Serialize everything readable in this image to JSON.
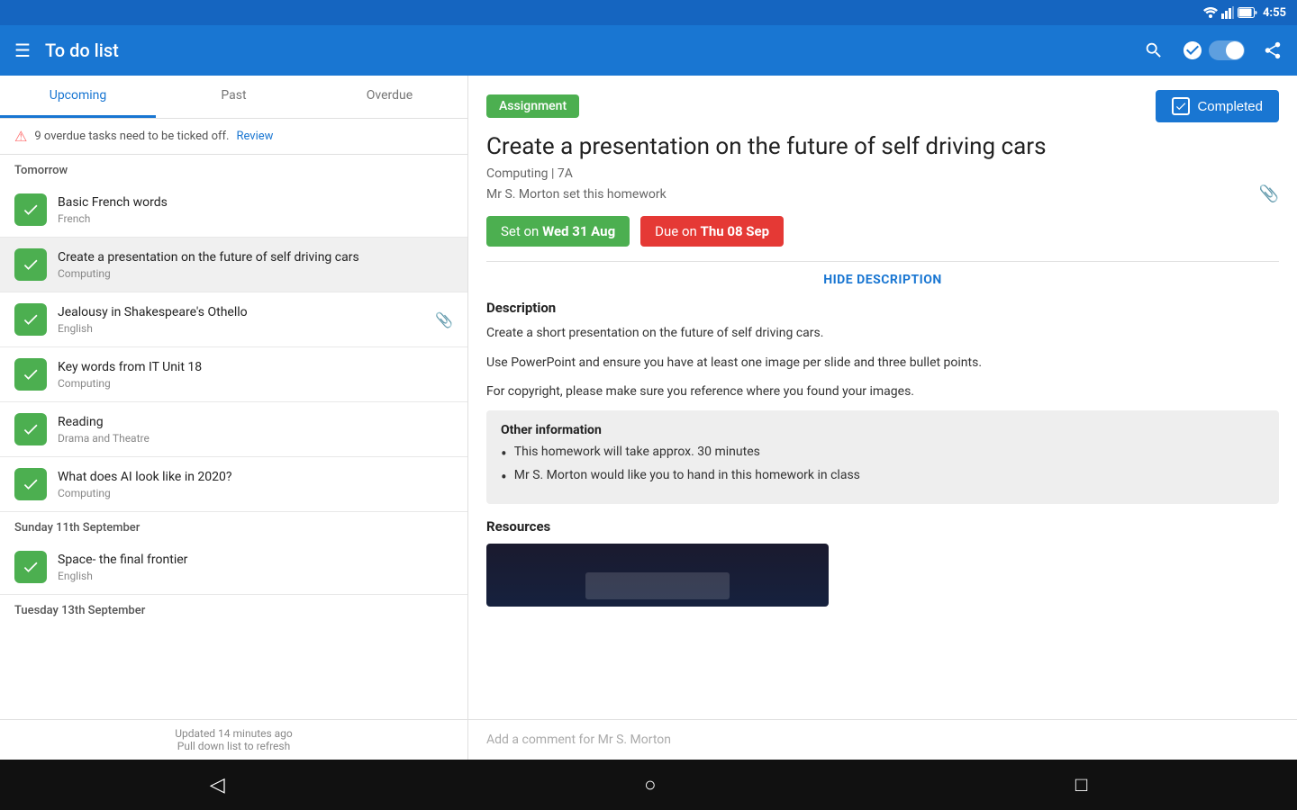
{
  "statusBar": {
    "time": "4:55"
  },
  "topBar": {
    "menuIcon": "☰",
    "title": "To do list",
    "searchIcon": "search",
    "checkIcon": "✓",
    "shareIcon": "share"
  },
  "tabs": [
    {
      "label": "Upcoming",
      "active": true
    },
    {
      "label": "Past",
      "active": false
    },
    {
      "label": "Overdue",
      "active": false
    }
  ],
  "warningBar": {
    "message": "9 overdue tasks need to be ticked off.",
    "reviewLabel": "Review"
  },
  "sections": [
    {
      "header": "Tomorrow",
      "tasks": [
        {
          "title": "Basic French words",
          "subject": "French",
          "checked": true,
          "attachment": false,
          "selected": false
        },
        {
          "title": "Create a presentation on the future of self driving cars",
          "subject": "Computing",
          "checked": true,
          "attachment": false,
          "selected": true
        },
        {
          "title": "Jealousy in Shakespeare's Othello",
          "subject": "English",
          "checked": true,
          "attachment": true,
          "selected": false
        },
        {
          "title": "Key words from IT Unit 18",
          "subject": "Computing",
          "checked": true,
          "attachment": false,
          "selected": false
        },
        {
          "title": "Reading",
          "subject": "Drama and Theatre",
          "checked": true,
          "attachment": false,
          "selected": false
        },
        {
          "title": "What does AI look like in 2020?",
          "subject": "Computing",
          "checked": true,
          "attachment": false,
          "selected": false
        }
      ]
    },
    {
      "header": "Sunday 11th September",
      "tasks": [
        {
          "title": "Space- the final frontier",
          "subject": "English",
          "checked": true,
          "attachment": false,
          "selected": false
        }
      ]
    },
    {
      "header": "Tuesday 13th September",
      "tasks": []
    }
  ],
  "bottomStatus": {
    "line1": "Updated 14 minutes ago",
    "line2": "Pull down list to refresh"
  },
  "detail": {
    "badgeLabel": "Assignment",
    "completedLabel": "Completed",
    "title": "Create a presentation on the future of self driving cars",
    "meta": "Computing | 7A",
    "teacher": "Mr S. Morton set this homework",
    "setOn": "Set on",
    "setDate": "Wed 31 Aug",
    "dueOn": "Due on",
    "dueDate": "Thu 08 Sep",
    "hideDescription": "HIDE DESCRIPTION",
    "descriptionLabel": "Description",
    "descriptionLines": [
      "Create a short presentation on the future of self driving cars.",
      "Use PowerPoint and ensure you have at least one image per slide and three bullet points.",
      "For copyright, please make sure you reference where you found your images."
    ],
    "otherInfoTitle": "Other information",
    "otherInfoItems": [
      "This homework will take approx. 30 minutes",
      "Mr S. Morton would like you to hand in this homework in class"
    ],
    "resourcesLabel": "Resources",
    "commentPlaceholder": "Add a comment for Mr S. Morton"
  },
  "bottomNav": {
    "back": "◁",
    "home": "○",
    "recent": "□"
  }
}
